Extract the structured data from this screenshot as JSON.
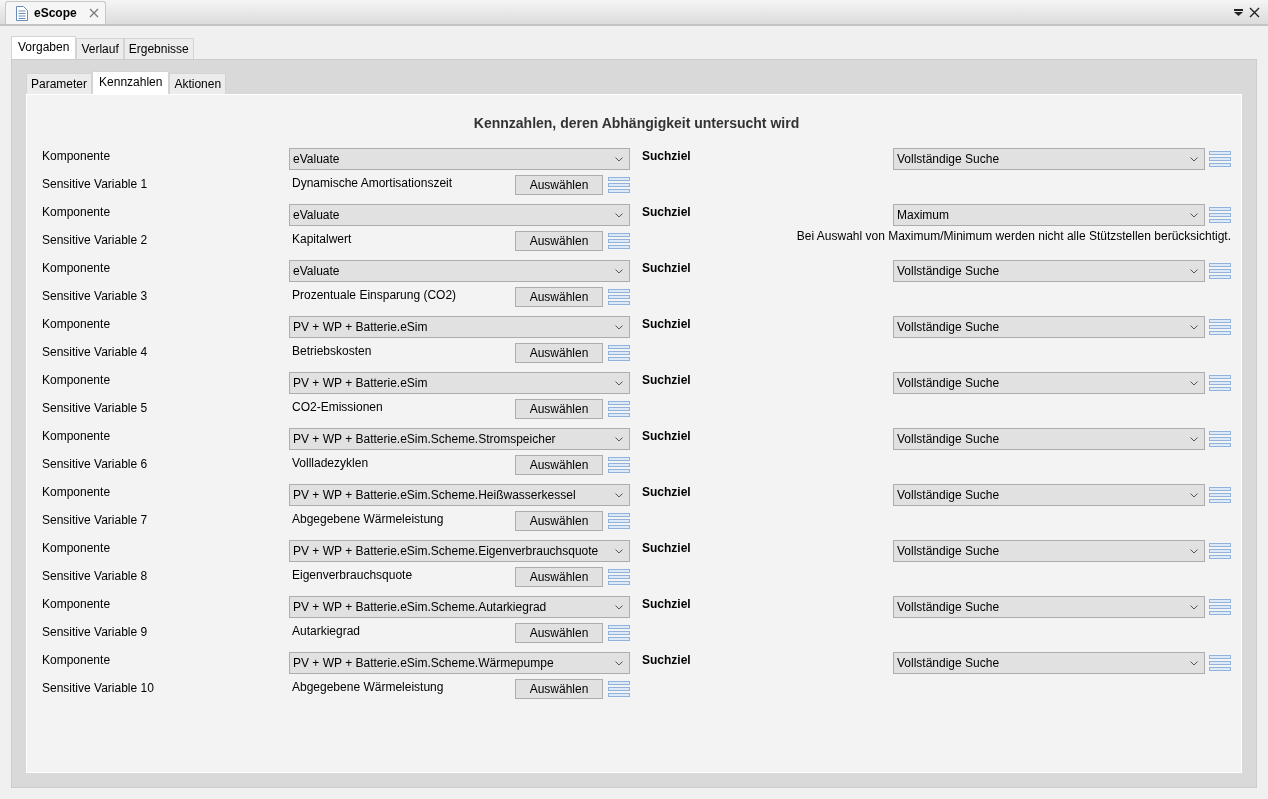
{
  "editor_tab": {
    "title": "eScope"
  },
  "outer_tabs": [
    {
      "label": "Vorgaben",
      "selected": true
    },
    {
      "label": "Verlauf",
      "selected": false
    },
    {
      "label": "Ergebnisse",
      "selected": false
    }
  ],
  "inner_tabs": [
    {
      "label": "Parameter",
      "selected": false
    },
    {
      "label": "Kennzahlen",
      "selected": true
    },
    {
      "label": "Aktionen",
      "selected": false
    }
  ],
  "heading": "Kennzahlen, deren Abhängigkeit untersucht wird",
  "groups": [
    {
      "component_label": "Komponente",
      "component": "eValuate",
      "goal_label": "Suchziel",
      "goal": "Vollständige Suche",
      "variable_label": "Sensitive Variable 1",
      "variable": "Dynamische Amortisationszeit",
      "button": "Auswählen"
    },
    {
      "component_label": "Komponente",
      "component": "eValuate",
      "goal_label": "Suchziel",
      "goal": "Maximum",
      "variable_label": "Sensitive Variable 2",
      "variable": "Kapitalwert",
      "button": "Auswählen",
      "note": "Bei Auswahl von Maximum/Minimum werden nicht alle Stützstellen berücksichtigt."
    },
    {
      "component_label": "Komponente",
      "component": "eValuate",
      "goal_label": "Suchziel",
      "goal": "Vollständige Suche",
      "variable_label": "Sensitive Variable 3",
      "variable": "Prozentuale Einsparung (CO2)",
      "button": "Auswählen"
    },
    {
      "component_label": "Komponente",
      "component": "PV + WP + Batterie.eSim",
      "goal_label": "Suchziel",
      "goal": "Vollständige Suche",
      "variable_label": "Sensitive Variable 4",
      "variable": "Betriebskosten",
      "button": "Auswählen"
    },
    {
      "component_label": "Komponente",
      "component": "PV + WP + Batterie.eSim",
      "goal_label": "Suchziel",
      "goal": "Vollständige Suche",
      "variable_label": "Sensitive Variable 5",
      "variable": "CO2-Emissionen",
      "button": "Auswählen"
    },
    {
      "component_label": "Komponente",
      "component": "PV + WP + Batterie.eSim.Scheme.Stromspeicher",
      "goal_label": "Suchziel",
      "goal": "Vollständige Suche",
      "variable_label": "Sensitive Variable 6",
      "variable": "Vollladezyklen",
      "button": "Auswählen"
    },
    {
      "component_label": "Komponente",
      "component": "PV + WP + Batterie.eSim.Scheme.Heißwasserkessel",
      "goal_label": "Suchziel",
      "goal": "Vollständige Suche",
      "variable_label": "Sensitive Variable 7",
      "variable": "Abgegebene Wärmeleistung",
      "button": "Auswählen"
    },
    {
      "component_label": "Komponente",
      "component": "PV + WP + Batterie.eSim.Scheme.Eigenverbrauchsquote",
      "goal_label": "Suchziel",
      "goal": "Vollständige Suche",
      "variable_label": "Sensitive Variable 8",
      "variable": "Eigenverbrauchsquote",
      "button": "Auswählen"
    },
    {
      "component_label": "Komponente",
      "component": "PV + WP + Batterie.eSim.Scheme.Autarkiegrad",
      "goal_label": "Suchziel",
      "goal": "Vollständige Suche",
      "variable_label": "Sensitive Variable 9",
      "variable": "Autarkiegrad",
      "button": "Auswählen"
    },
    {
      "component_label": "Komponente",
      "component": "PV + WP + Batterie.eSim.Scheme.Wärmepumpe",
      "goal_label": "Suchziel",
      "goal": "Vollständige Suche",
      "variable_label": "Sensitive Variable 10",
      "variable": "Abgegebene Wärmeleistung",
      "button": "Auswählen"
    }
  ]
}
